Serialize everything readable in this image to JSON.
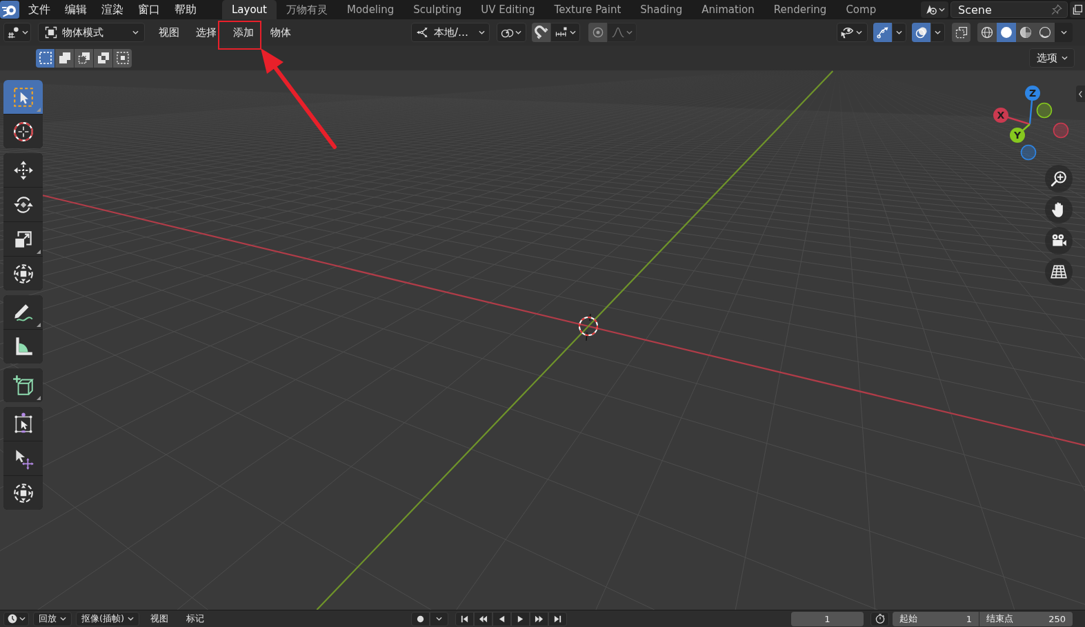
{
  "top_bar": {
    "menus": [
      {
        "label": "文件"
      },
      {
        "label": "编辑"
      },
      {
        "label": "渲染"
      },
      {
        "label": "窗口"
      },
      {
        "label": "帮助"
      }
    ],
    "workspace_tabs": [
      {
        "label": "Layout",
        "selected": true
      },
      {
        "label": "万物有灵",
        "selected": false
      },
      {
        "label": "Modeling",
        "selected": false
      },
      {
        "label": "Sculpting",
        "selected": false
      },
      {
        "label": "UV Editing",
        "selected": false
      },
      {
        "label": "Texture Paint",
        "selected": false
      },
      {
        "label": "Shading",
        "selected": false
      },
      {
        "label": "Animation",
        "selected": false
      },
      {
        "label": "Rendering",
        "selected": false
      },
      {
        "label": "Comp",
        "selected": false
      }
    ],
    "scene": {
      "value": "Scene"
    }
  },
  "viewport_header": {
    "mode": {
      "value": "物体模式"
    },
    "menus": [
      {
        "label": "视图",
        "highlighted": false
      },
      {
        "label": "选择",
        "highlighted": false
      },
      {
        "label": "添加",
        "highlighted": true
      },
      {
        "label": "物体",
        "highlighted": false
      }
    ],
    "orientation": {
      "value": "本地/…"
    },
    "snapping": {
      "on": false
    },
    "proportional_editing": {
      "on": false
    },
    "gizmos": {
      "on": true
    },
    "overlays": {
      "on": true
    },
    "xray": {
      "on": false
    },
    "shading_modes": [
      {
        "kind": "wireframe",
        "selected": false
      },
      {
        "kind": "solid",
        "selected": true
      },
      {
        "kind": "material",
        "selected": false
      },
      {
        "kind": "rendered",
        "selected": false
      }
    ]
  },
  "tool_settings": {
    "select_modes": [
      {
        "kind": "set",
        "selected": true
      },
      {
        "kind": "extend",
        "selected": false
      },
      {
        "kind": "subtract",
        "selected": false
      },
      {
        "kind": "invert",
        "selected": false
      },
      {
        "kind": "intersect",
        "selected": false
      }
    ],
    "options": {
      "label": "选项"
    }
  },
  "toolbar": [
    {
      "tools": [
        {
          "kind": "select",
          "selected": true,
          "more_tools": true
        },
        {
          "kind": "cursor",
          "selected": false,
          "more_tools": false
        }
      ]
    },
    {
      "tools": [
        {
          "kind": "move",
          "selected": false,
          "more_tools": false
        },
        {
          "kind": "rotate",
          "selected": false,
          "more_tools": false
        },
        {
          "kind": "scale",
          "selected": false,
          "more_tools": true
        },
        {
          "kind": "transform",
          "selected": false,
          "more_tools": false
        }
      ]
    },
    {
      "tools": [
        {
          "kind": "annotate",
          "selected": false,
          "more_tools": true
        },
        {
          "kind": "measure",
          "selected": false,
          "more_tools": false
        }
      ]
    },
    {
      "tools": [
        {
          "kind": "cube",
          "selected": false,
          "more_tools": true
        }
      ]
    },
    {
      "tools": [
        {
          "kind": "cage",
          "selected": false,
          "more_tools": false
        },
        {
          "kind": "nudge",
          "selected": false,
          "more_tools": false
        },
        {
          "kind": "transform",
          "selected": false,
          "more_tools": false
        }
      ]
    }
  ],
  "navigation_gizmo": {
    "axes": [
      {
        "kind": "z",
        "label": "Z",
        "color": "#2e85e4"
      },
      {
        "kind": "x",
        "label": "X",
        "color": "#cb3a50"
      },
      {
        "kind": "y",
        "label": "Y",
        "color": "#86c81f"
      }
    ]
  },
  "timeline_header": {
    "playback": {
      "label": "回放"
    },
    "keying": {
      "label": "抠像(插帧)"
    },
    "menus": [
      {
        "label": "视图"
      },
      {
        "label": "标记"
      }
    ],
    "current_frame": {
      "value": "1"
    },
    "start_frame": {
      "label": "起始",
      "value": "1"
    },
    "end_frame": {
      "label": "结束点",
      "value": "250"
    }
  }
}
